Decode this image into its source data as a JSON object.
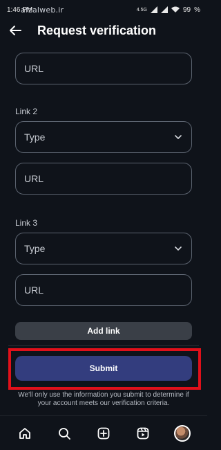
{
  "status_bar": {
    "time": "1:46 PM",
    "watermark": "afzalweb.ir",
    "network": "4.5G",
    "battery": "99"
  },
  "header": {
    "title": "Request verification",
    "back_icon": "arrow-left-icon"
  },
  "form": {
    "url_placeholder_1": "URL",
    "link2_label": "Link 2",
    "link2_type": "Type",
    "link2_url": "URL",
    "link3_label": "Link 3",
    "link3_type": "Type",
    "link3_url": "URL",
    "add_link_label": "Add link",
    "submit_label": "Submit",
    "note": "We'll only use the information you submit to determine if your account meets our verification criteria."
  },
  "bottom_nav": {
    "items": [
      "home-icon",
      "search-icon",
      "create-icon",
      "reels-icon",
      "profile-avatar"
    ]
  },
  "colors": {
    "background": "#0f131a",
    "submit_bg": "#333d7e",
    "highlight": "#e0101a",
    "field_border": "#5c6470"
  }
}
